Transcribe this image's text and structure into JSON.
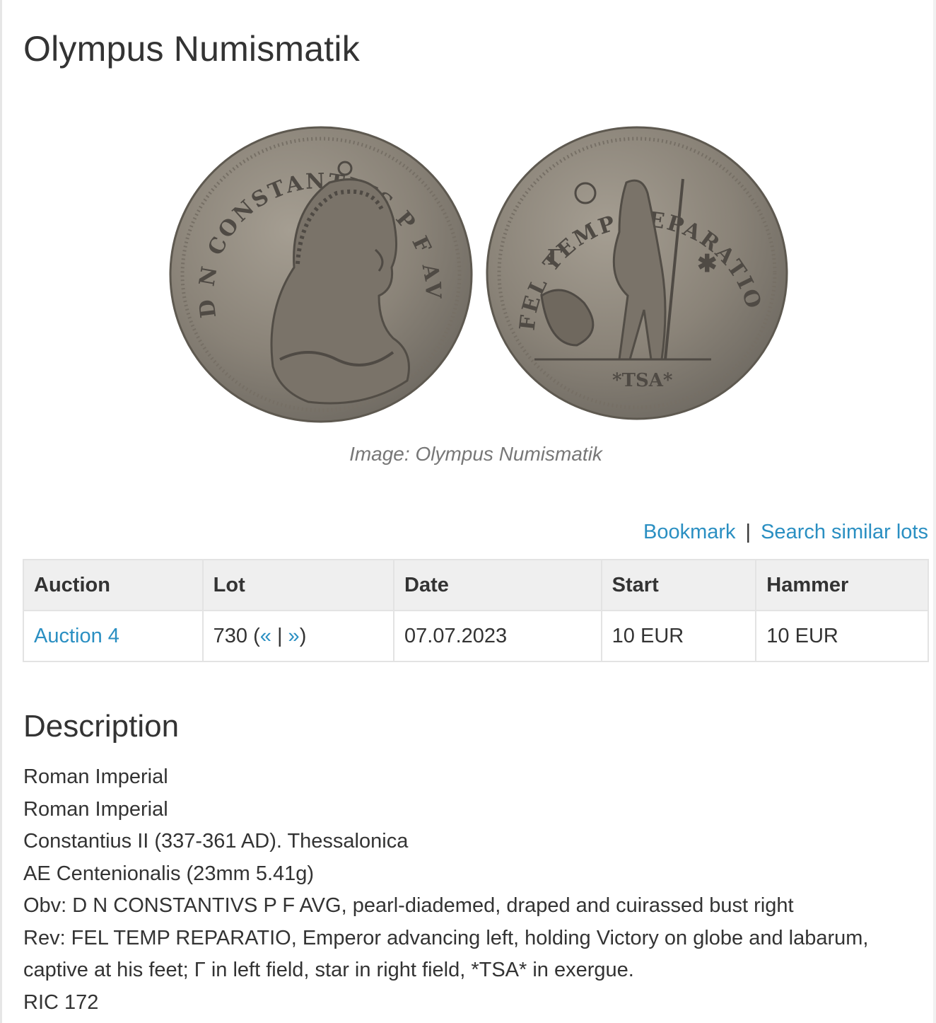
{
  "page": {
    "title": "Olympus Numismatik"
  },
  "image": {
    "caption": "Image: Olympus Numismatik",
    "obverse_legend": "D N CONSTANTIVS P F AVG",
    "reverse_legend": "FEL TEMP REPARATIO",
    "reverse_exergue": "*TSA*",
    "colors": {
      "coin_base": "#8a8378",
      "coin_edge": "#6f6a62",
      "coin_highlight": "#a59e92",
      "relief_dark": "#4f4a44"
    }
  },
  "actions": {
    "bookmark": "Bookmark",
    "separator": "|",
    "search_similar": "Search similar lots"
  },
  "table": {
    "headers": [
      "Auction",
      "Lot",
      "Date",
      "Start",
      "Hammer"
    ],
    "row": {
      "auction": "Auction 4",
      "lot_number": "730 (",
      "prev": "«",
      "lot_sep": " | ",
      "next": "»",
      "lot_close": ")",
      "date": "07.07.2023",
      "start": "10 EUR",
      "hammer": "10 EUR"
    }
  },
  "description": {
    "title": "Description",
    "lines": [
      "Roman Imperial",
      "Roman Imperial",
      "Constantius II (337-361 AD). Thessalonica",
      "AE Centenionalis (23mm 5.41g)",
      "Obv: D N CONSTANTIVS P F AVG, pearl-diademed, draped and cuirassed bust right",
      "Rev: FEL TEMP REPARATIO, Emperor advancing left, holding Victory on globe and labarum,",
      "captive at his feet; Γ in left field, star in right field, *TSA* in exergue.",
      "RIC 172"
    ]
  },
  "colors": {
    "link": "#2a8fc2",
    "header_bg": "#efefef",
    "border": "#e3e3e3",
    "caption": "#777777"
  }
}
